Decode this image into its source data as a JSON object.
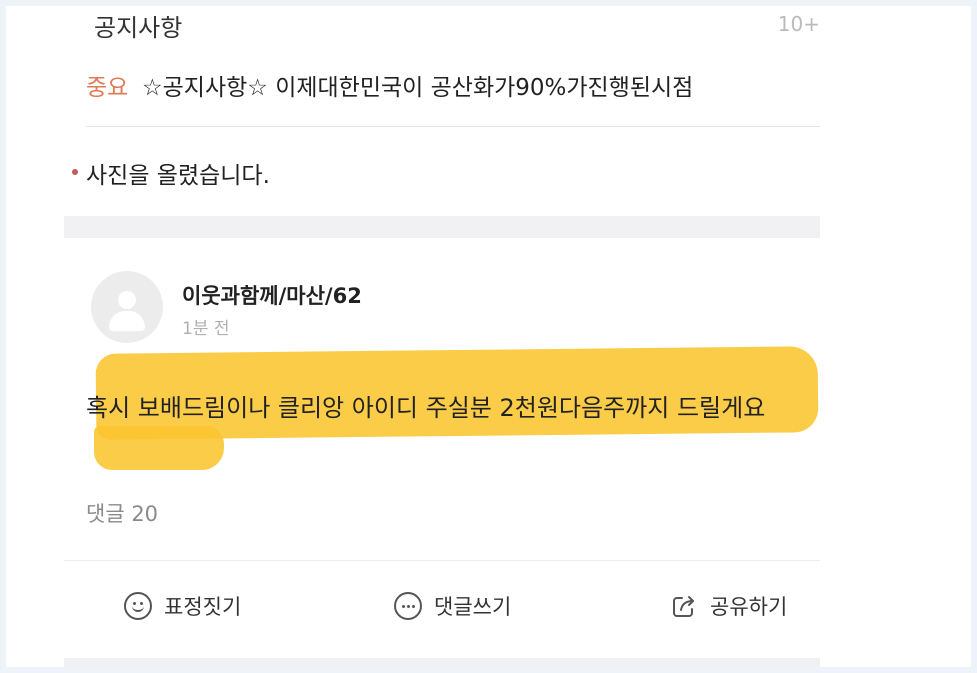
{
  "notice": {
    "title": "공지사항",
    "count": "10+",
    "badge": "중요",
    "item_text": "☆공지사항☆ 이제대한민국이 공산화가90%가진행된시점"
  },
  "announcement": {
    "text": "사진을 올렸습니다."
  },
  "post": {
    "author": "이웃과함께/마산/62",
    "time": "1분 전",
    "body": "혹시 보배드림이나 클리앙 아이디 주실분 2천원다음주까지 드릴게요",
    "comment_count": "댓글 20"
  },
  "actions": {
    "react_label": "표정짓기",
    "comment_label": "댓글쓰기",
    "share_label": "공유하기"
  },
  "colors": {
    "important_badge": "#e07a55",
    "highlight": "#fbc52f",
    "bullet": "#c65a5a"
  },
  "icons": {
    "avatar": "default-user-icon",
    "react": "smiley-icon",
    "comment": "speech-bubble-icon",
    "share": "share-icon"
  }
}
